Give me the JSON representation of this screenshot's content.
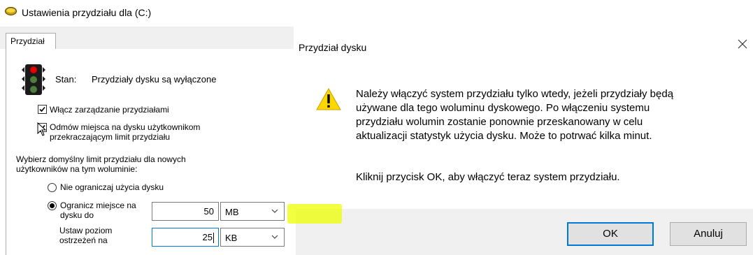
{
  "left_window": {
    "title": "Ustawienia przydziału dla  (C:)",
    "tab": "Przydział",
    "status_label": "Stan:",
    "status_value": "Przydziały dysku są wyłączone",
    "enable_quota_label": "Włącz zarządzanie przydziałami",
    "enable_quota_checked": true,
    "deny_space_label_line1": "Odmów miejsca na dysku użytkownikom",
    "deny_space_label_line2": "przekraczającym limit przydziału",
    "deny_space_checked": true,
    "default_limit_line1": "Wybierz domyślny limit przydziału dla nowych",
    "default_limit_line2": "użytkowników na tym woluminie:",
    "no_limit_label": "Nie ograniczaj użycia dysku",
    "limit_label_line1": "Ogranicz miejsce na",
    "limit_label_line2": "dysku do",
    "limit_value": "50",
    "limit_unit": "MB",
    "warning_label_line1": "Ustaw poziom",
    "warning_label_line2": "ostrzeżeń na",
    "warning_value": "25",
    "warning_unit": "KB"
  },
  "dialog": {
    "title": "Przydział dysku",
    "message_line1": "Należy włączyć system przydziału tylko wtedy, jeżeli przydziały będą",
    "message_line2": "używane dla tego woluminu dyskowego. Po włączeniu systemu",
    "message_line3": "przydziału wolumin zostanie ponownie przeskanowany w celu",
    "message_line4": "aktualizacji statystyk użycia dysku. Może to potrwać kilka minut.",
    "message2": "Kliknij przycisk OK, aby włączyć teraz system przydziału.",
    "ok_label": "OK",
    "cancel_label": "Anuluj"
  },
  "colors": {
    "accent": "#0078d7",
    "highlight": "#eeff00",
    "button_bg": "#e1e1e1",
    "bar_bg": "#f0f0f0"
  }
}
